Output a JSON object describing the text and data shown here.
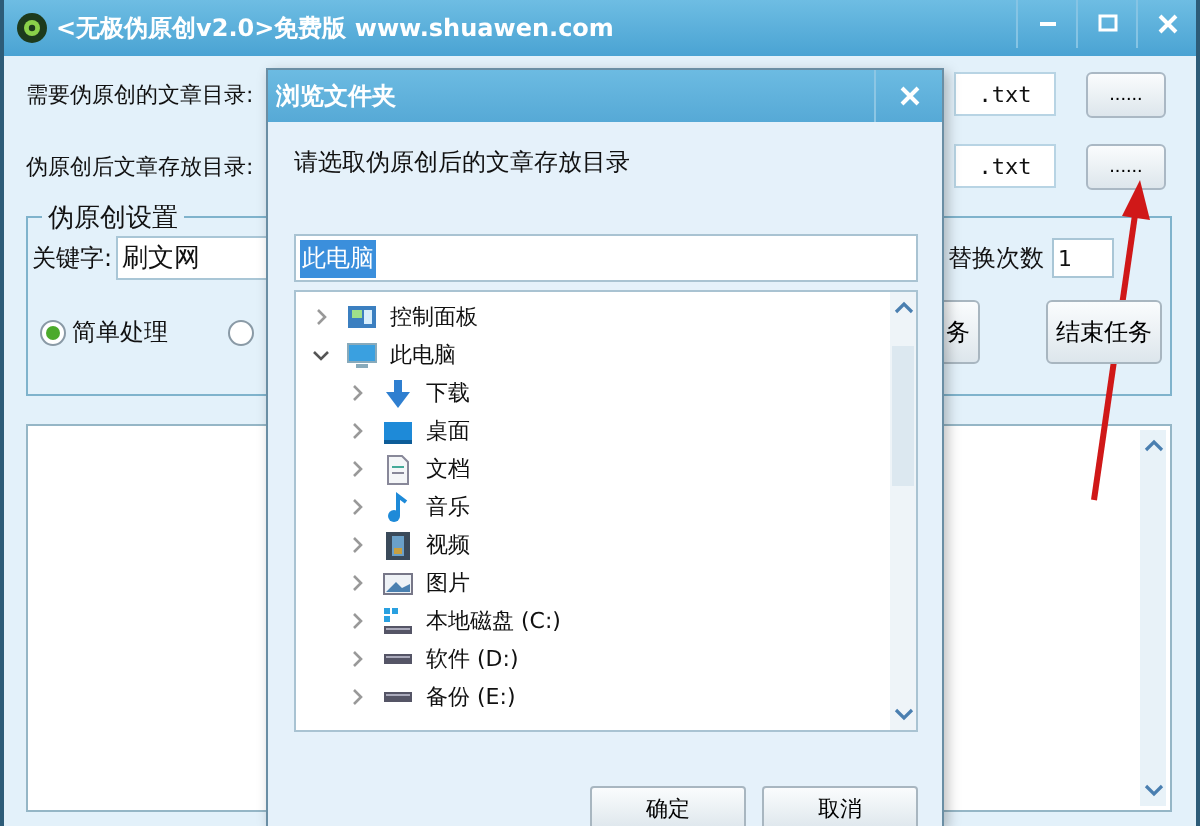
{
  "window": {
    "title": "<无极伪原创v2.0>免费版 www.shuawen.com"
  },
  "source_row": {
    "label": "需要伪原创的文章目录:",
    "extension": ".txt",
    "browse_button": "......"
  },
  "output_row": {
    "label": "伪原创后文章存放目录:",
    "extension": ".txt",
    "browse_button": "......"
  },
  "settings": {
    "title": "伪原创设置",
    "keyword_label": "关键字:",
    "keyword_value": "刷文网",
    "replace_label": "替换次数",
    "replace_value": "1",
    "modes": [
      {
        "label": "简单处理",
        "selected": true
      },
      {
        "selected": false
      }
    ],
    "buttons": [
      {
        "label": "务"
      },
      {
        "label": "结束任务"
      }
    ]
  },
  "dialog": {
    "title": "浏览文件夹",
    "prompt": "请选取伪原创后的文章存放目录",
    "folder_value": "此电脑",
    "tree": [
      {
        "kind": "control-panel",
        "label": "控制面板",
        "expanded": false
      },
      {
        "kind": "computer",
        "label": "此电脑",
        "expanded": true,
        "children": [
          {
            "kind": "download",
            "label": "下载",
            "expanded": false
          },
          {
            "kind": "desktop",
            "label": "桌面",
            "expanded": false
          },
          {
            "kind": "documents",
            "label": "文档",
            "expanded": false
          },
          {
            "kind": "music",
            "label": "音乐",
            "expanded": false
          },
          {
            "kind": "videos",
            "label": "视频",
            "expanded": false
          },
          {
            "kind": "pictures",
            "label": "图片",
            "expanded": false
          },
          {
            "kind": "system-drive",
            "label": "本地磁盘 (C:)",
            "expanded": false
          },
          {
            "kind": "drive",
            "label": "软件 (D:)",
            "expanded": false
          },
          {
            "kind": "drive",
            "label": "备份 (E:)",
            "expanded": false
          }
        ]
      }
    ],
    "buttons": [
      "确定",
      "取消"
    ]
  }
}
